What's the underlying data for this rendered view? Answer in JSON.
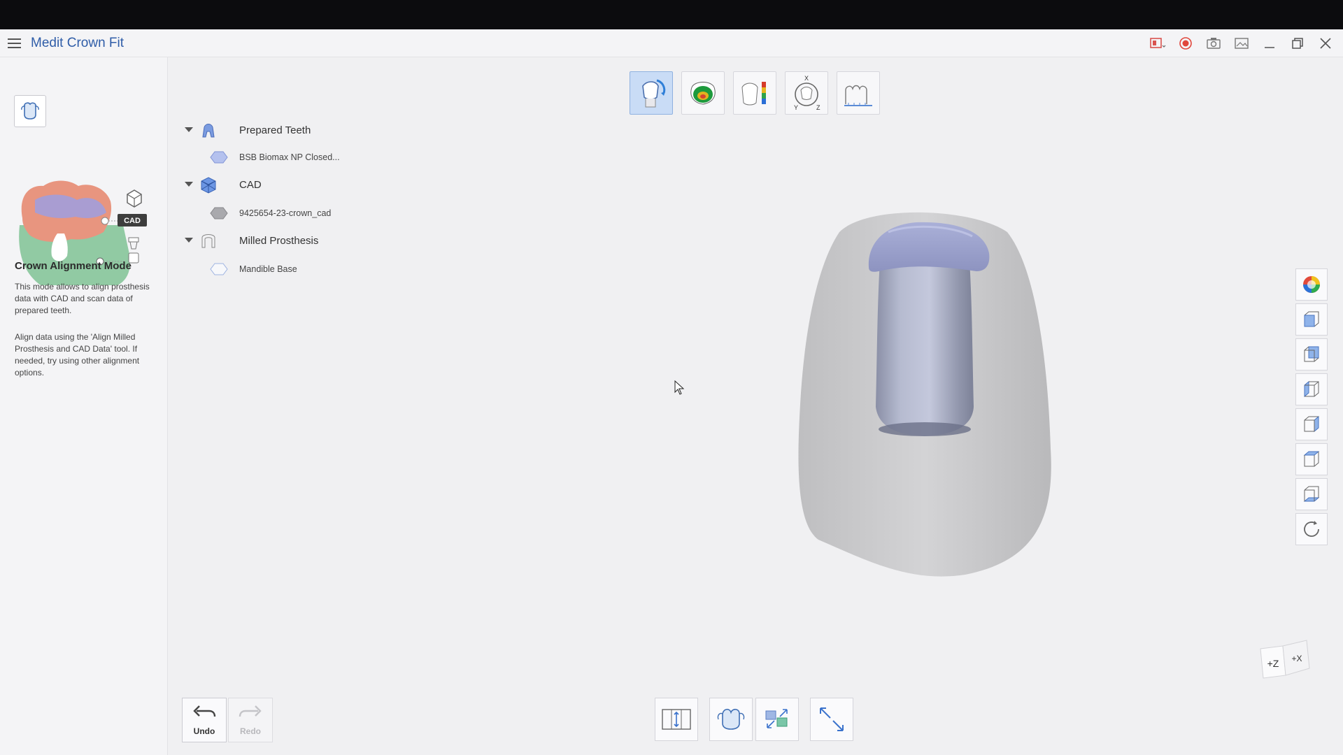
{
  "app": {
    "title": "Medit Crown Fit"
  },
  "sidebar": {
    "badge": "CAD",
    "mode_title": "Crown Alignment Mode",
    "desc1": "This mode allows to align prosthesis data with CAD and scan data of prepared teeth.",
    "desc2": "Align data using the 'Align Milled Prosthesis and CAD Data' tool. If needed, try using other alignment options."
  },
  "tree": {
    "groups": [
      {
        "label": "Prepared Teeth",
        "items": [
          "BSB Biomax NP Closed..."
        ]
      },
      {
        "label": "CAD",
        "items": [
          "9425654-23-crown_cad"
        ]
      },
      {
        "label": "Milled Prosthesis",
        "items": [
          "Mandible Base"
        ]
      }
    ]
  },
  "top_tools": [
    "align-tool-icon",
    "occlusion-tool-icon",
    "deviation-tool-icon",
    "xyz-axis-tool-icon",
    "measure-tool-icon"
  ],
  "right_tools": [
    "color-wheel-icon",
    "view-front-icon",
    "view-back-icon",
    "view-left-icon",
    "view-right-icon",
    "view-top-icon",
    "view-bottom-icon",
    "reset-view-icon"
  ],
  "bottom": {
    "undo": "Undo",
    "redo": "Redo"
  },
  "axis": {
    "z": "+Z",
    "x": "+X"
  },
  "colors": {
    "accent": "#2f5da8",
    "active_tool": "#c9dcf6",
    "crown": "#9aa0c8",
    "gingiva": "#c8c8c8"
  }
}
